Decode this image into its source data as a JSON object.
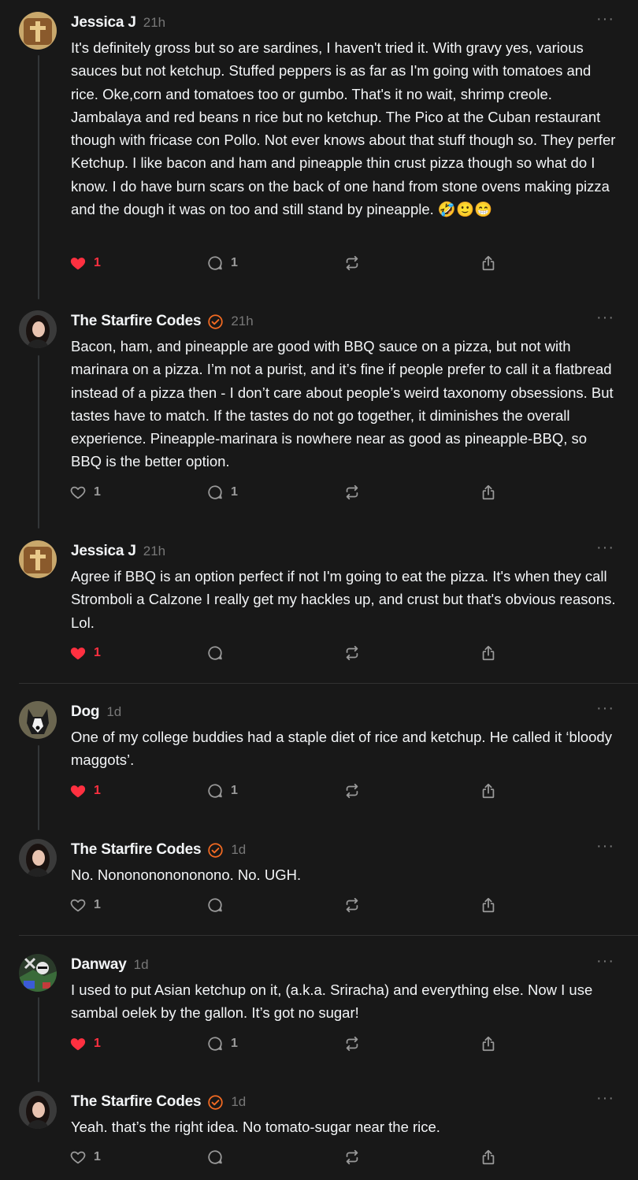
{
  "colors": {
    "background": "#181818",
    "text": "#f3f5f7",
    "muted": "#777777",
    "like": "#ff3040",
    "verified": "#f26a22"
  },
  "posts": [
    {
      "author": "Jessica J",
      "time": "21h",
      "verified": false,
      "avatar_icon": "cross-avatar-icon",
      "more": "···",
      "text": "It's definitely gross but so are sardines, I haven't tried it. With gravy yes, various sauces but not ketchup. Stuffed peppers is as far as I'm going with tomatoes and rice. Oke,corn and tomatoes too or gumbo. That's it no wait, shrimp creole. Jambalaya and red beans n rice but no ketchup. The Pico at the Cuban restaurant though with fricase con Pollo. Not ever knows about that stuff though so. They perfer Ketchup. I like bacon and ham and pineapple thin crust pizza though so what do I know. I do have burn scars on the back of one hand from stone ovens making pizza and the dough it was on too and still stand by pineapple. 🤣🙂😁",
      "liked": true,
      "likes": "1",
      "replies": "1"
    },
    {
      "author": "The Starfire Codes",
      "time": "21h",
      "verified": true,
      "avatar_icon": "woman-avatar-icon",
      "more": "···",
      "text": "Bacon, ham, and pineapple are good with BBQ sauce on a pizza, but not with marinara on a pizza. I’m not a purist, and it’s fine if people prefer to call it a flatbread instead of a pizza then - I don’t care about people’s weird taxonomy obsessions. But tastes have to match. If the tastes do not go together, it diminishes the overall experience. Pineapple-marinara is nowhere near as good as pineapple-BBQ, so BBQ is the better option.",
      "liked": false,
      "likes": "1",
      "replies": "1"
    },
    {
      "author": "Jessica J",
      "time": "21h",
      "verified": false,
      "avatar_icon": "cross-avatar-icon",
      "more": "···",
      "text": "Agree if BBQ is an option perfect if not I'm going to eat the pizza. It's when they call Stromboli a Calzone I really get my hackles up, and crust but that's obvious reasons. Lol.",
      "liked": true,
      "likes": "1",
      "replies": ""
    },
    {
      "author": "Dog",
      "time": "1d",
      "verified": false,
      "avatar_icon": "dog-avatar-icon",
      "more": "···",
      "text": "One of my college buddies had a staple diet of rice and ketchup. He called it ‘bloody maggots’.",
      "liked": true,
      "likes": "1",
      "replies": "1"
    },
    {
      "author": "The Starfire Codes",
      "time": "1d",
      "verified": true,
      "avatar_icon": "woman-avatar-icon",
      "more": "···",
      "text": "No. Nononononononono. No. UGH.",
      "liked": false,
      "likes": "1",
      "replies": ""
    },
    {
      "author": "Danway",
      "time": "1d",
      "verified": false,
      "avatar_icon": "pirate-avatar-icon",
      "more": "···",
      "text": "I used to put Asian ketchup on it, (a.k.a. Sriracha) and everything else. Now I use sambal oelek by the gallon. It’s got no sugar!",
      "liked": true,
      "likes": "1",
      "replies": "1"
    },
    {
      "author": "The Starfire Codes",
      "time": "1d",
      "verified": true,
      "avatar_icon": "woman-avatar-icon",
      "more": "···",
      "text": "Yeah. that’s the right idea. No tomato-sugar near the rice.",
      "liked": false,
      "likes": "1",
      "replies": ""
    }
  ]
}
